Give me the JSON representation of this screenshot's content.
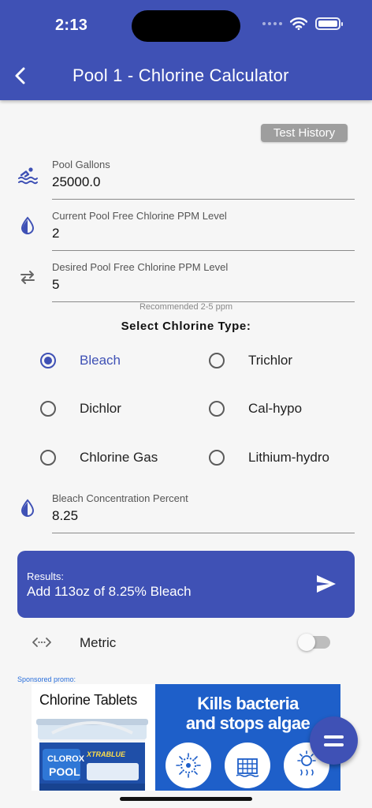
{
  "status_bar": {
    "time": "2:13"
  },
  "header": {
    "title": "Pool 1 - Chlorine Calculator"
  },
  "test_history": {
    "label": "Test History"
  },
  "fields": {
    "gallons": {
      "label": "Pool Gallons",
      "value": "25000.0"
    },
    "current_ppm": {
      "label": "Current Pool Free Chlorine PPM Level",
      "value": "2"
    },
    "desired_ppm": {
      "label": "Desired Pool Free Chlorine PPM Level",
      "value": "5"
    },
    "concentration": {
      "label": "Bleach Concentration Percent",
      "value": "8.25"
    }
  },
  "hint": "Recommended 2-5 ppm",
  "chlorine_type": {
    "title": "Select Chlorine Type:",
    "selected": "Bleach",
    "options": [
      "Bleach",
      "Trichlor",
      "Dichlor",
      "Cal-hypo",
      "Chlorine Gas",
      "Lithium-hydro"
    ]
  },
  "results": {
    "title": "Results:",
    "text": "Add 113oz of 8.25% Bleach"
  },
  "metric": {
    "label": "Metric",
    "enabled": false
  },
  "promo": {
    "label": "Sponsored promo:",
    "left_title": "Chlorine Tablets",
    "right_line1": "Kills bacteria",
    "right_line2": "and stops algae",
    "brand": "CLOROX",
    "product": "POOL",
    "product_line": "XTRABLUE"
  },
  "icons": {
    "back": "chevron-left-icon",
    "gallons": "pool-swimmer-icon",
    "current_ppm": "water-drop-icon",
    "desired_ppm": "swap-arrows-icon",
    "concentration": "water-drop-icon",
    "send": "send-icon",
    "metric": "code-arrows-icon",
    "fab": "menu-icon"
  },
  "colors": {
    "primary": "#3f51b5",
    "background": "#f6f6f6",
    "chip": "#9e9e9e",
    "promo_blue": "#1e5fc9"
  }
}
